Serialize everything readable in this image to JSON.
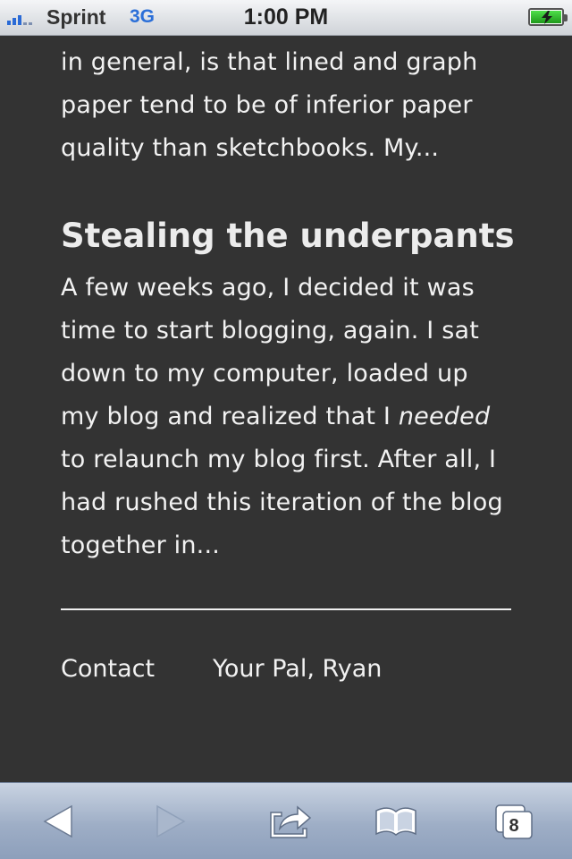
{
  "status_bar": {
    "carrier": "Sprint",
    "network": "3G",
    "time": "1:00 PM",
    "signal_bars": 3,
    "battery_icon": "battery-charging-icon"
  },
  "post_prev": {
    "excerpt": "in general, is that lined and graph paper tend to be of inferior paper quality than sketchbooks. My..."
  },
  "post": {
    "title": "Stealing the underpants",
    "excerpt_before": "A few weeks ago, I decided it was time to start blogging, again. I sat down to my computer, loaded up my blog and realized that I ",
    "excerpt_emphasis": "needed",
    "excerpt_after": " to relaunch my blog first. After all, I had rushed this iteration of the blog together in..."
  },
  "footer": {
    "contact_label": "Contact",
    "signature": "Your Pal, Ryan"
  },
  "toolbar": {
    "back_icon": "back-arrow-icon",
    "forward_icon": "forward-arrow-icon",
    "share_icon": "share-icon",
    "bookmarks_icon": "bookmarks-icon",
    "tabs_icon": "tabs-icon",
    "tabs_count": "8"
  },
  "colors": {
    "background": "#333333",
    "text": "#f2f2f2",
    "network_blue": "#2b6fd8"
  }
}
